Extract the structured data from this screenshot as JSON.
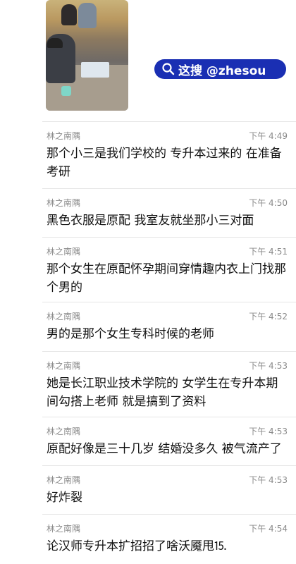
{
  "badge": {
    "text": "这搜 @zhesou",
    "icon": "search-icon",
    "color": "#1a2fb3"
  },
  "messages": [
    {
      "sender": "林之南隅",
      "time": "下午 4:49",
      "text": "那个小三是我们学校的 专升本过来的 在准备考研"
    },
    {
      "sender": "林之南隅",
      "time": "下午 4:50",
      "text": "黑色衣服是原配 我室友就坐那小三对面"
    },
    {
      "sender": "林之南隅",
      "time": "下午 4:51",
      "text": "那个女生在原配怀孕期间穿情趣内衣上门找那个男的"
    },
    {
      "sender": "林之南隅",
      "time": "下午 4:52",
      "text": "男的是那个女生专科时候的老师"
    },
    {
      "sender": "林之南隅",
      "time": "下午 4:53",
      "text": "她是长江职业技术学院的 女学生在专升本期间勾搭上老师 就是搞到了资料"
    },
    {
      "sender": "林之南隅",
      "time": "下午 4:53",
      "text": "原配好像是三十几岁 结婚没多久 被气流产了"
    },
    {
      "sender": "林之南隅",
      "time": "下午 4:53",
      "text": "好炸裂"
    },
    {
      "sender": "林之南隅",
      "time": "下午 4:54",
      "text": "论汉师专升本扩招招了啥沃魇甩⒖"
    }
  ]
}
